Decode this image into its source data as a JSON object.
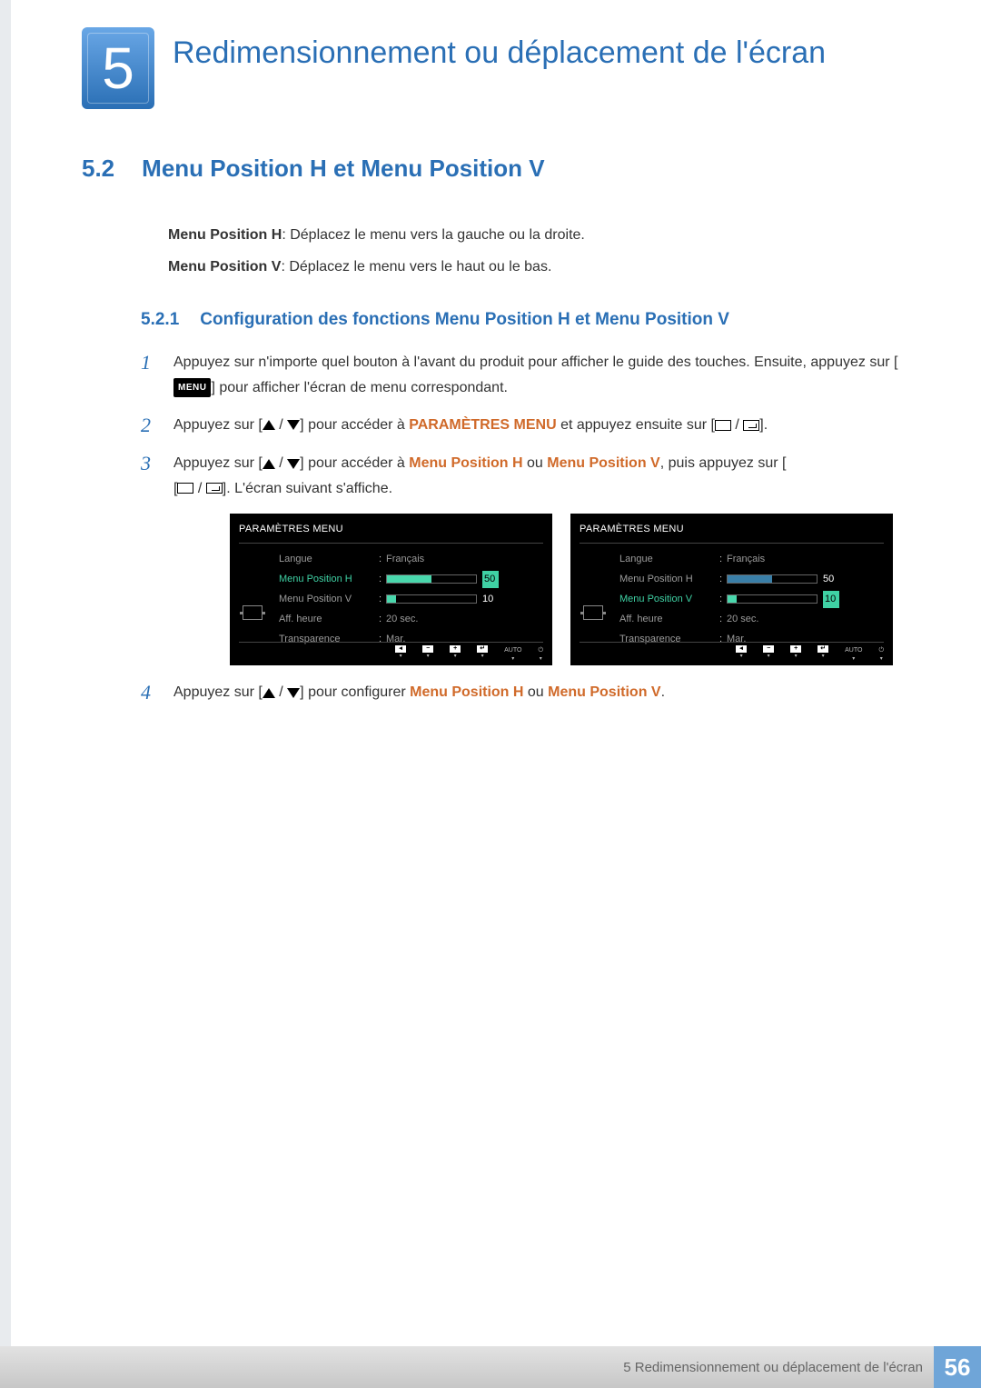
{
  "chapter": {
    "number": "5",
    "title": "Redimensionnement ou déplacement de l'écran"
  },
  "section": {
    "number": "5.2",
    "title": "Menu Position H et Menu Position V"
  },
  "intro": {
    "h_label": "Menu Position H",
    "h_text": ": Déplacez le menu vers la gauche ou la droite.",
    "v_label": "Menu Position V",
    "v_text": ": Déplacez le menu vers le haut ou le bas."
  },
  "subsection": {
    "number": "5.2.1",
    "title": "Configuration des fonctions Menu Position H et Menu Position V"
  },
  "steps": {
    "s1a": "Appuyez sur n'importe quel bouton à l'avant du produit pour afficher le guide des touches. Ensuite, appuyez sur [",
    "menu_chip": "MENU",
    "s1b": "] pour afficher l'écran de menu correspondant.",
    "s2a": "Appuyez sur [",
    "s2b": "] pour accéder à ",
    "param": "PARAMÈTRES MENU",
    "s2c": " et appuyez ensuite sur [",
    "s2d": "].",
    "s3a": "Appuyez sur [",
    "s3b": "] pour accéder à ",
    "mph": "Menu Position H",
    "or": " ou ",
    "mpv": "Menu Position V",
    "s3c": ", puis appuyez sur [",
    "s3d": "]. L'écran suivant s'affiche.",
    "s4a": "Appuyez sur [",
    "s4b": "] pour configurer ",
    "s4c": "."
  },
  "osd": {
    "title": "PARAMÈTRES MENU",
    "rows": {
      "langue": "Langue",
      "mph": "Menu Position H",
      "mpv": "Menu Position V",
      "aff": "Aff. heure",
      "trans": "Transparence"
    },
    "vals": {
      "langue": "Français",
      "aff": "20 sec.",
      "trans": "Mar.",
      "fifty": "50",
      "ten": "10"
    },
    "bottom": {
      "auto": "AUTO"
    }
  },
  "footer": {
    "text": "5 Redimensionnement ou déplacement de l'écran",
    "page": "56"
  }
}
